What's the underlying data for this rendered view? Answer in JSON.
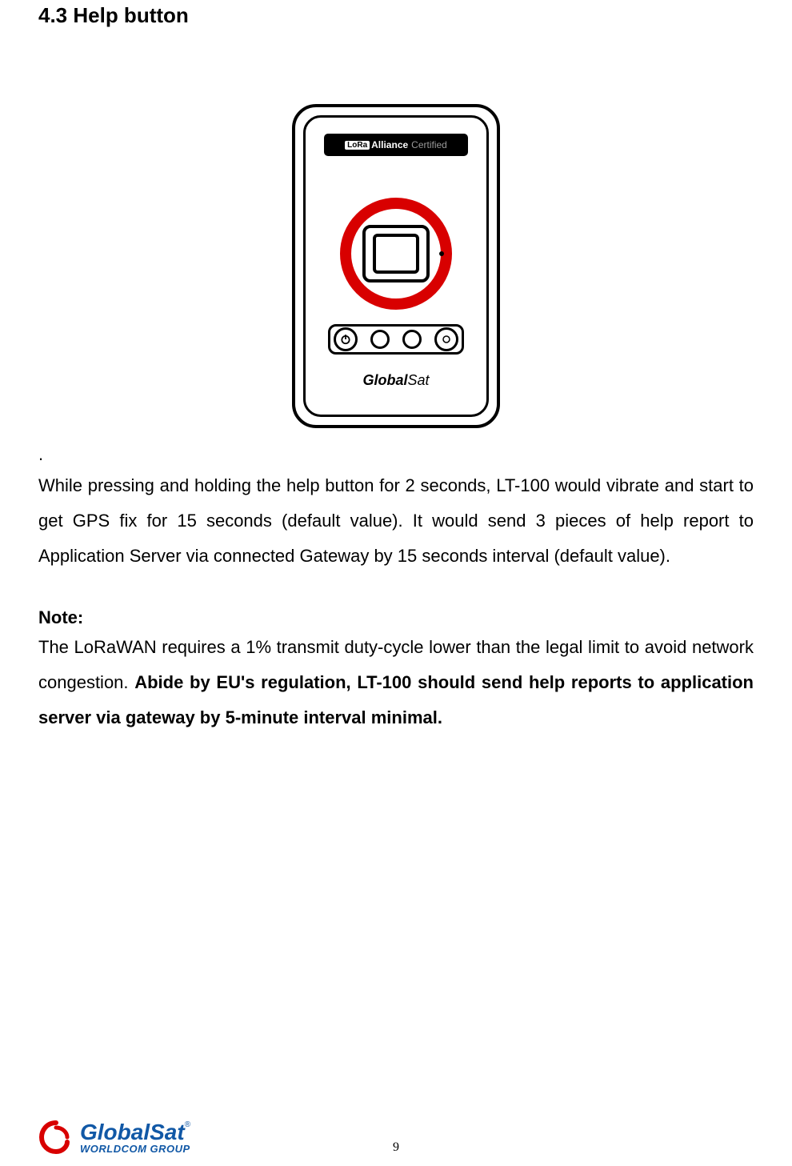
{
  "heading": "4.3 Help button",
  "device": {
    "badge_lora": "LoRa",
    "badge_alliance": "Alliance",
    "badge_certified": "Certified",
    "brand_bold": "Global",
    "brand_light": "Sat"
  },
  "dot": ".",
  "paragraph": "While pressing and holding the help button for 2 seconds, LT-100 would vibrate and start to get GPS fix for 15 seconds (default value). It would send 3 pieces of help report to Application Server via connected Gateway by 15 seconds interval (default value).",
  "note_label": "Note:",
  "note_pre": "The LoRaWAN requires a 1% transmit duty-cycle lower than the legal limit to avoid network congestion. ",
  "note_bold": "Abide by EU's regulation, LT-100 should send help reports to application server via gateway by 5-minute interval minimal.",
  "footer": {
    "global": "Global",
    "sat": "Sat",
    "reg": "®",
    "sub": "WORLDCOM GROUP"
  },
  "page_number": "9"
}
